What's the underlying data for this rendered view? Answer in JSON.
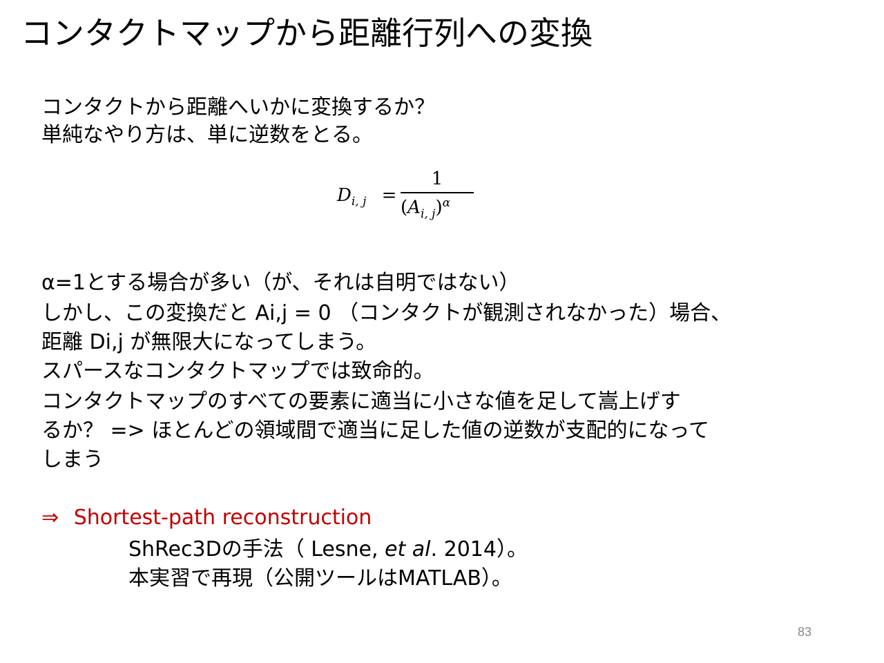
{
  "title": "コンタクトマップから距離行列への変換",
  "intro": [
    "コンタクトから距離へいかに変換するか？",
    "単純なやり方は、単に逆数をとる。"
  ],
  "equation": {
    "lhs_main": "D",
    "lhs_sub": "i, j",
    "equals": "=",
    "numerator": "1",
    "den_open": "(",
    "den_main": "A",
    "den_sub": "i, j",
    "den_close": ")",
    "exponent": "α"
  },
  "body_lines": [
    "α=1とする場合が多い（が、それは自明ではない）",
    "しかし、この変換だと Ai,j = 0 （コンタクトが観測されなかった）場合、",
    "距離 Di,j が無限大になってしまう。",
    "スパースなコンタクトマップでは致命的。",
    "コンタクトマップのすべての要素に適当に小さな値を足して嵩上げす",
    "るか？ => ほとんどの領域間で適当に足した値の逆数が支配的になって",
    "しまう"
  ],
  "conclusion": {
    "arrow": "⇒",
    "heading": "Shortest-path reconstruction",
    "ref_pre": "ShRec3Dの手法（ Lesne, ",
    "ref_em": "et al",
    "ref_post": ". 2014）。",
    "note": "本実習で再現（公開ツールはMATLAB）。"
  },
  "page_number": "83",
  "colors": {
    "accent_red": "#c00000",
    "page_number": "#888888"
  }
}
